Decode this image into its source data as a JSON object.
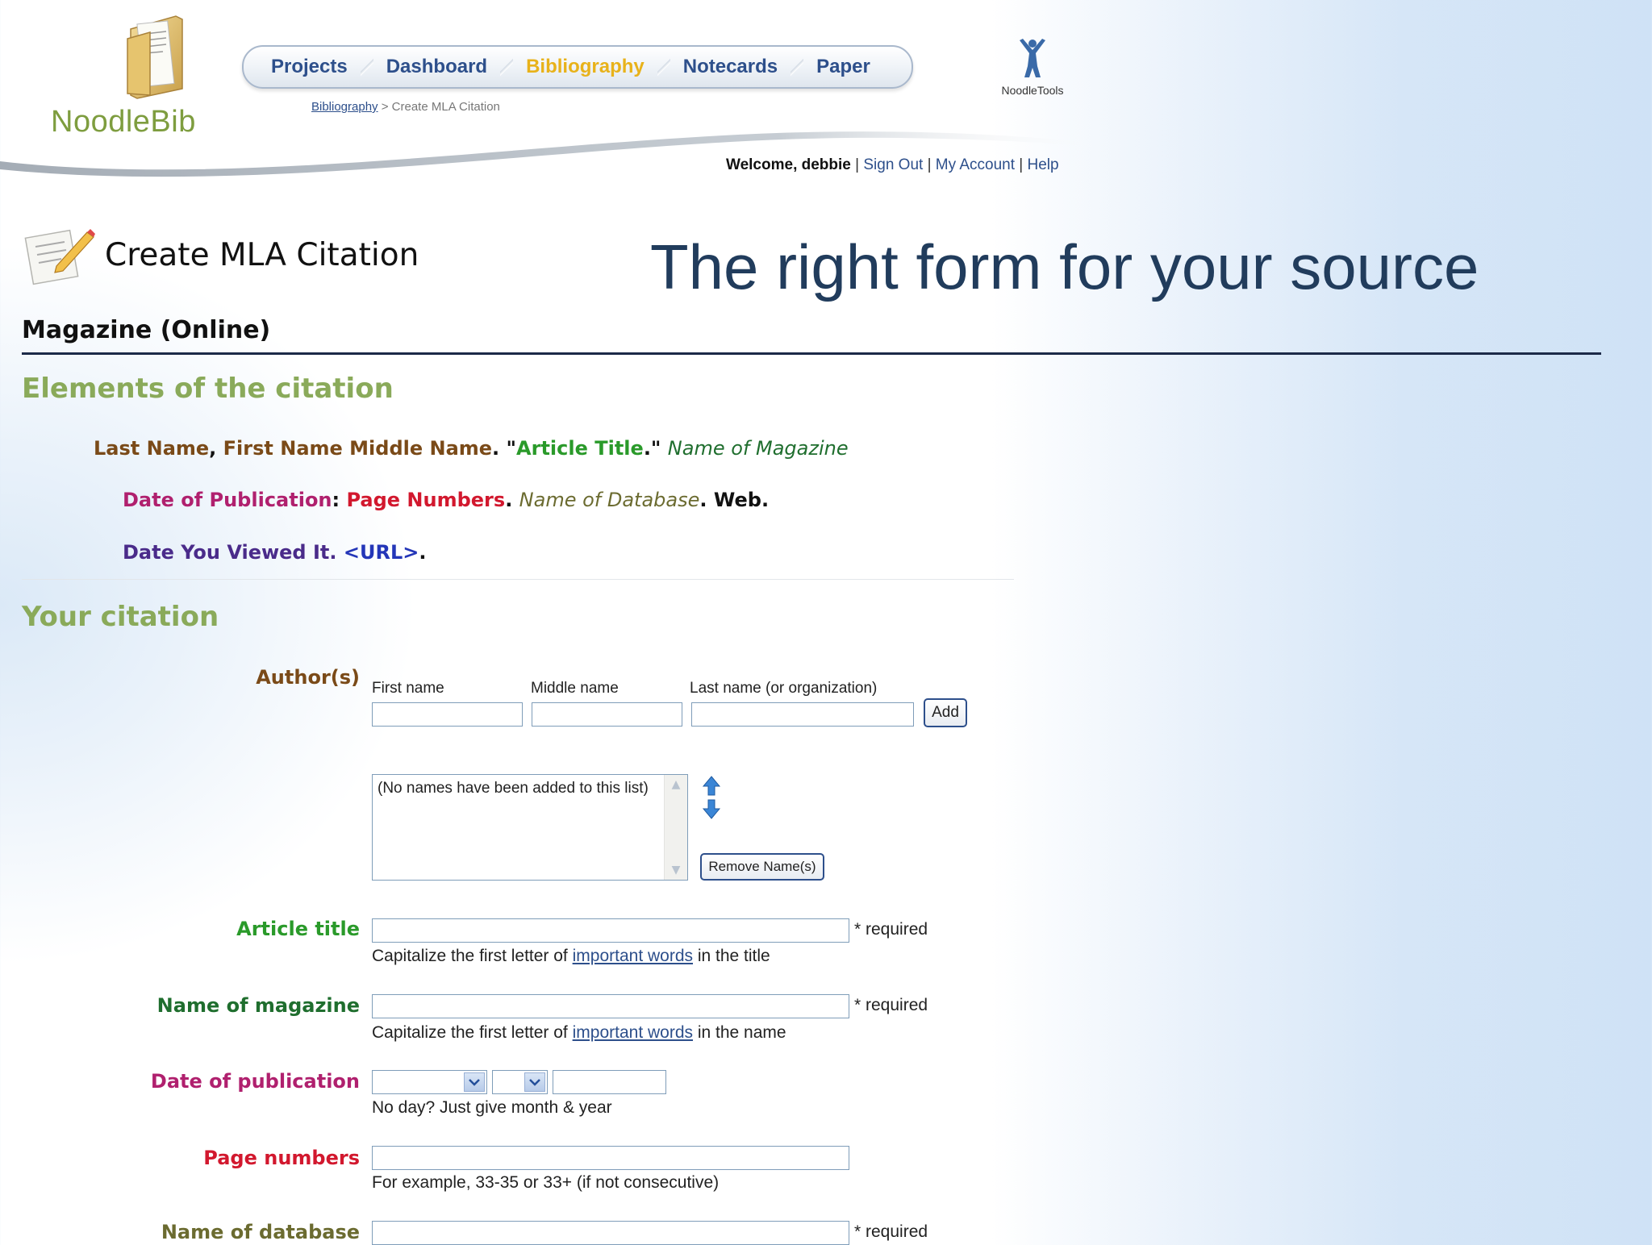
{
  "app": {
    "logo_text": "NoodleBib",
    "partner_logo_text": "NoodleTools"
  },
  "nav": {
    "items": [
      {
        "label": "Projects"
      },
      {
        "label": "Dashboard"
      },
      {
        "label": "Bibliography",
        "active": true
      },
      {
        "label": "Notecards"
      },
      {
        "label": "Paper"
      }
    ]
  },
  "breadcrumb": {
    "link": "Bibliography",
    "separator": ">",
    "current": "Create MLA Citation"
  },
  "userbar": {
    "welcome": "Welcome, debbie",
    "sep": "|",
    "sign_out": "Sign Out",
    "my_account": "My Account",
    "help": "Help"
  },
  "page": {
    "title": "Create MLA Citation",
    "overlay_title": "The right form for your source",
    "source_type": "Magazine (Online)"
  },
  "elements_section": {
    "heading": "Elements of the citation",
    "line1": {
      "last_name": "Last Name",
      "comma": ", ",
      "first_middle": "First Name Middle Name",
      "dot_quote": ". \"",
      "article_title": "Article Title",
      "close_quote": ".\" ",
      "magazine": "Name of Magazine"
    },
    "line2": {
      "date_pub": "Date of Publication",
      "colon": ": ",
      "pages": "Page Numbers",
      "dot1": ". ",
      "database": "Name of Database",
      "dot2": ". ",
      "web": "Web."
    },
    "line3": {
      "date_viewed": "Date You Viewed It.",
      "space": " ",
      "url": "<URL>",
      "dot": "."
    }
  },
  "citation_section": {
    "heading": "Your citation",
    "authors": {
      "label": "Author(s)",
      "first_name_label": "First name",
      "middle_name_label": "Middle name",
      "last_name_label": "Last name (or organization)",
      "first_name_value": "",
      "middle_name_value": "",
      "last_name_value": "",
      "add_label": "Add",
      "list_empty_text": "(No names have been added to this list)",
      "remove_label": "Remove Name(s)"
    },
    "article_title": {
      "label": "Article title",
      "value": "",
      "required": "* required",
      "hint_pre": "Capitalize the first letter of ",
      "hint_link": "important words",
      "hint_post": " in the title"
    },
    "magazine": {
      "label": "Name of magazine",
      "value": "",
      "required": "* required",
      "hint_pre": "Capitalize the first letter of ",
      "hint_link": "important words",
      "hint_post": " in the name"
    },
    "date_publication": {
      "label": "Date of publication",
      "month_value": "",
      "day_value": "",
      "year_value": "",
      "hint": "No day? Just give month & year"
    },
    "page_numbers": {
      "label": "Page numbers",
      "value": "",
      "hint": "For example, 33-35 or 33+ (if not consecutive)"
    },
    "database": {
      "label": "Name of database",
      "value": "",
      "required": "* required"
    }
  }
}
